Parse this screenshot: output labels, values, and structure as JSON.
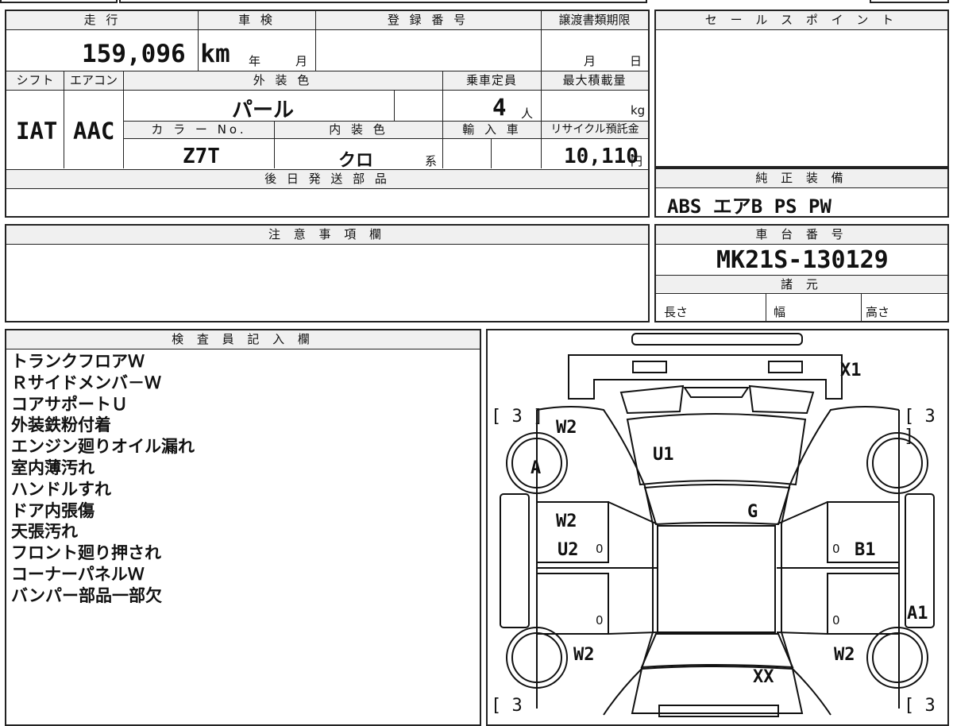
{
  "top_block": {
    "mileage_header": "走 行",
    "mileage": "159,096 km",
    "shaken_header": "車 検",
    "shaken_year_unit": "年",
    "shaken_month_unit": "月",
    "reg_header": "登 録 番 号",
    "transfer_header": "譲渡書類期限",
    "transfer_month_unit": "月",
    "transfer_day_unit": "日",
    "shift_header": "シフト",
    "shift": "IAT",
    "ac_header": "エアコン",
    "ac": "AAC",
    "ext_color_header": "外 装 色",
    "ext_color": "パール",
    "capacity_header": "乗車定員",
    "capacity": "4",
    "capacity_unit": "人",
    "max_load_header": "最大積載量",
    "max_load_unit": "kg",
    "color_no_header": "カ ラ ー No.",
    "color_no": "Z7T",
    "int_color_header": "内 装 色",
    "int_color": "クロ",
    "int_color_suffix": "系",
    "import_header": "輸 入 車",
    "recycle_header": "リサイクル預託金",
    "recycle": "10,110",
    "recycle_unit": "円",
    "later_parts_header": "後 日 発 送 部 品"
  },
  "sales_point": {
    "header": "セ ー ル ス ポ イ ン ト"
  },
  "equipment": {
    "header": "純 正 装 備",
    "value": "ABS エアB PS PW"
  },
  "caution": {
    "header": "注 意 事 項 欄"
  },
  "chassis": {
    "header": "車 台 番 号",
    "value": "MK21S-130129",
    "spec_header": "諸 元",
    "length_label": "長さ",
    "width_label": "幅",
    "height_label": "高さ"
  },
  "inspector": {
    "header": "検 査 員 記 入 欄",
    "notes": [
      "トランクフロアＷ",
      "Ｒサイドメンバ－Ｗ",
      "コアサポートＵ",
      "外装鉄粉付着",
      "エンジン廻りオイル漏れ",
      "室内薄汚れ",
      "ハンドルすれ",
      "ドア内張傷",
      "天張汚れ",
      "フロント廻り押され",
      "コーナーパネルＷ",
      "バンパー部品一部欠"
    ]
  },
  "diagram": {
    "tire_tl": "[ 3 ]",
    "tire_tr": "[ 3 ]",
    "tire_bl": "[ 3",
    "tire_br": "[ 3",
    "marks": {
      "x1": "X1",
      "w2_tl": "W2",
      "u1": "U1",
      "a": "A",
      "g": "G",
      "w2_ml": "W2",
      "u2": "U2",
      "b1": "B1",
      "a1": "A1",
      "w2_bl": "W2",
      "w2_br": "W2",
      "xx": "XX",
      "zero1": "0",
      "zero2": "0",
      "zero3": "0",
      "zero4": "0"
    }
  }
}
